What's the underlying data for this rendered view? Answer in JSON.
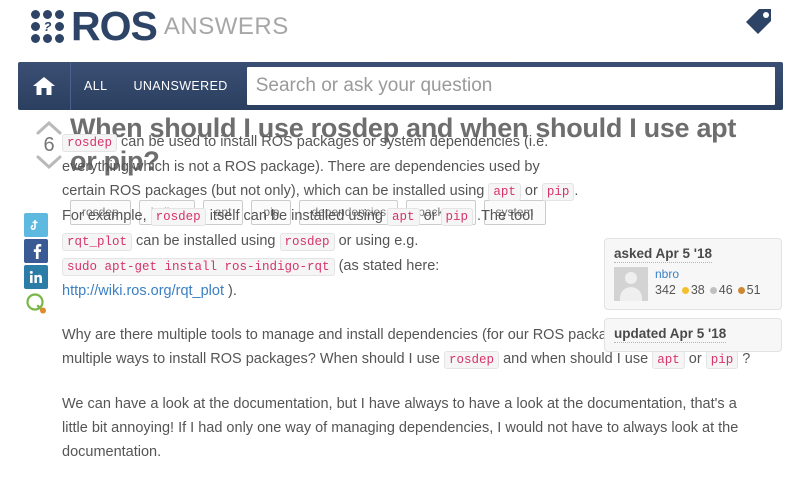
{
  "site": {
    "logo_primary": "ROS",
    "logo_secondary": "ANSWERS",
    "logo_question_mark": "?",
    "tag_icon": "tag-icon",
    "brand_color": "#2e4467"
  },
  "navbar": {
    "home_icon": "home-icon",
    "links": [
      {
        "label": "ALL"
      },
      {
        "label": "UNANSWERED"
      }
    ],
    "search": {
      "placeholder": "Search or ask your question",
      "value": ""
    }
  },
  "question": {
    "title": "When should I use rosdep and when should I use apt or pip?",
    "vote_count": "6",
    "upvote_icon": "chevron-up-icon",
    "downvote_icon": "chevron-down-icon",
    "tags": [
      {
        "label": "rosdep"
      },
      {
        "label": "indigo"
      },
      {
        "label": "apt"
      },
      {
        "label": "pip"
      },
      {
        "label": "dependencies"
      },
      {
        "label": "package"
      },
      {
        "label": "system"
      }
    ]
  },
  "share": {
    "items": [
      {
        "name": "twitter-icon",
        "glyph": "t"
      },
      {
        "name": "facebook-icon",
        "glyph": "f"
      },
      {
        "name": "linkedin-icon",
        "glyph": "in"
      },
      {
        "name": "identica-icon",
        "glyph": ""
      }
    ]
  },
  "body": {
    "p1": {
      "c1": "rosdep",
      "t1": " can be used to install ROS packages or system dependencies (i.e. everything which is not a ROS package). There are dependencies used by certain ROS packages (but not only), which can be installed using ",
      "c2": "apt",
      "t2": " or ",
      "c3": "pip",
      "t3": ". For example, ",
      "c4": "rosdep",
      "t4": " itself can be installed using ",
      "c5": "apt",
      "t5": " or ",
      "c6": "pip",
      "t6": " .The tool ",
      "c7": "rqt_plot",
      "t7": " can be installed using ",
      "c8": "rosdep",
      "t8": " or using e.g. ",
      "c9": "sudo apt-get install ros-indigo-rqt",
      "t9": " (as stated here: ",
      "link": "http://wiki.ros.org/rqt_plot",
      "t10": " )."
    },
    "p2": {
      "t1": "Why are there multiple tools to manage and install dependencies (for our ROS packages)? Why are there multiple ways to install ROS packages? When should I use ",
      "c1": "rosdep",
      "t2": " and when should I use ",
      "c2": "apt",
      "t3": " or ",
      "c3": "pip",
      "t4": " ?"
    },
    "p3": {
      "text": "We can have a look at the documentation, but I have always to have a look at the documentation, that's a little bit annoying! If I had only one way of managing dependencies, I would not have to always look at the documentation."
    }
  },
  "sidebar": {
    "asked_label": "asked Apr 5 '18",
    "updated_label": "updated Apr 5 '18",
    "user": {
      "name": "nbro",
      "karma": "342",
      "gold": "38",
      "silver": "46",
      "bronze": "51"
    }
  }
}
